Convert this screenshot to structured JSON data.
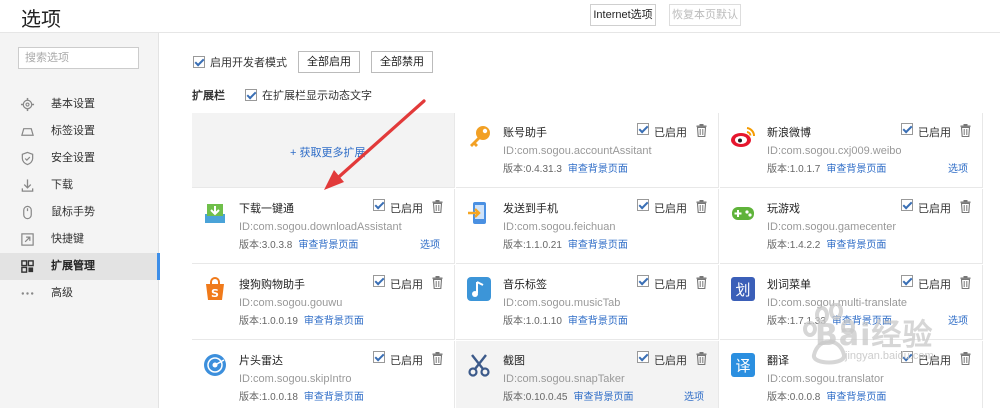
{
  "header": {
    "title": "选项",
    "internet_button": "Internet选项",
    "restore_button": "恢复本页默认"
  },
  "sidebar": {
    "search_placeholder": "搜索选项",
    "items": [
      {
        "label": "基本设置",
        "icon": "gear-icon"
      },
      {
        "label": "标签设置",
        "icon": "tab-icon"
      },
      {
        "label": "安全设置",
        "icon": "shield-icon"
      },
      {
        "label": "下载",
        "icon": "download-icon"
      },
      {
        "label": "鼠标手势",
        "icon": "mouse-icon"
      },
      {
        "label": "快捷键",
        "icon": "shortcut-icon"
      },
      {
        "label": "扩展管理",
        "icon": "extensions-icon",
        "active": true
      },
      {
        "label": "高级",
        "icon": "more-icon"
      }
    ]
  },
  "main": {
    "dev_mode_label": "启用开发者模式",
    "enable_all_button": "全部启用",
    "disable_all_button": "全部禁用",
    "ext_bar_title": "扩展栏",
    "ext_bar_dynamic_label": "在扩展栏显示动态文字",
    "get_more_label": "+ 获取更多扩展",
    "enabled_label": "已启用",
    "bg_page_label": "审查背景页面",
    "options_label": "选项",
    "extensions": [
      {
        "name": "账号助手",
        "id": "ID:com.sogou.accountAssitant",
        "version": "版本:0.4.31.3",
        "options": false,
        "icon": "key-icon"
      },
      {
        "name": "新浪微博",
        "id": "ID:com.sogou.cxj009.weibo",
        "version": "版本:1.0.1.7",
        "options": true,
        "icon": "weibo-icon"
      },
      {
        "name": "下载一键通",
        "id": "ID:com.sogou.downloadAssistant",
        "version": "版本:3.0.3.8",
        "options": true,
        "icon": "download-assistant-icon"
      },
      {
        "name": "发送到手机",
        "id": "ID:com.sogou.feichuan",
        "version": "版本:1.1.0.21",
        "options": false,
        "icon": "send-to-phone-icon"
      },
      {
        "name": "玩游戏",
        "id": "ID:com.sogou.gamecenter",
        "version": "版本:1.4.2.2",
        "options": false,
        "icon": "gamepad-icon"
      },
      {
        "name": "搜狗购物助手",
        "id": "ID:com.sogou.gouwu",
        "version": "版本:1.0.0.19",
        "options": false,
        "icon": "shopping-icon"
      },
      {
        "name": "音乐标签",
        "id": "ID:com.sogou.musicTab",
        "version": "版本:1.0.1.10",
        "options": false,
        "icon": "music-icon"
      },
      {
        "name": "划词菜单",
        "id": "ID:com.sogou.multi-translate",
        "version": "版本:1.7.1.33",
        "options": true,
        "icon": "translate-menu-icon"
      },
      {
        "name": "片头雷达",
        "id": "ID:com.sogou.skipIntro",
        "version": "版本:1.0.0.18",
        "options": false,
        "icon": "radar-icon"
      },
      {
        "name": "截图",
        "id": "ID:com.sogou.snapTaker",
        "version": "版本:0.10.0.45",
        "options": true,
        "icon": "scissors-icon"
      },
      {
        "name": "翻译",
        "id": "ID:com.sogou.translator",
        "version": "版本:0.0.0.8",
        "options": false,
        "icon": "translate-icon"
      }
    ]
  },
  "watermark": {
    "text": "Bai经验",
    "sub": "jingyan.baidu.com"
  }
}
